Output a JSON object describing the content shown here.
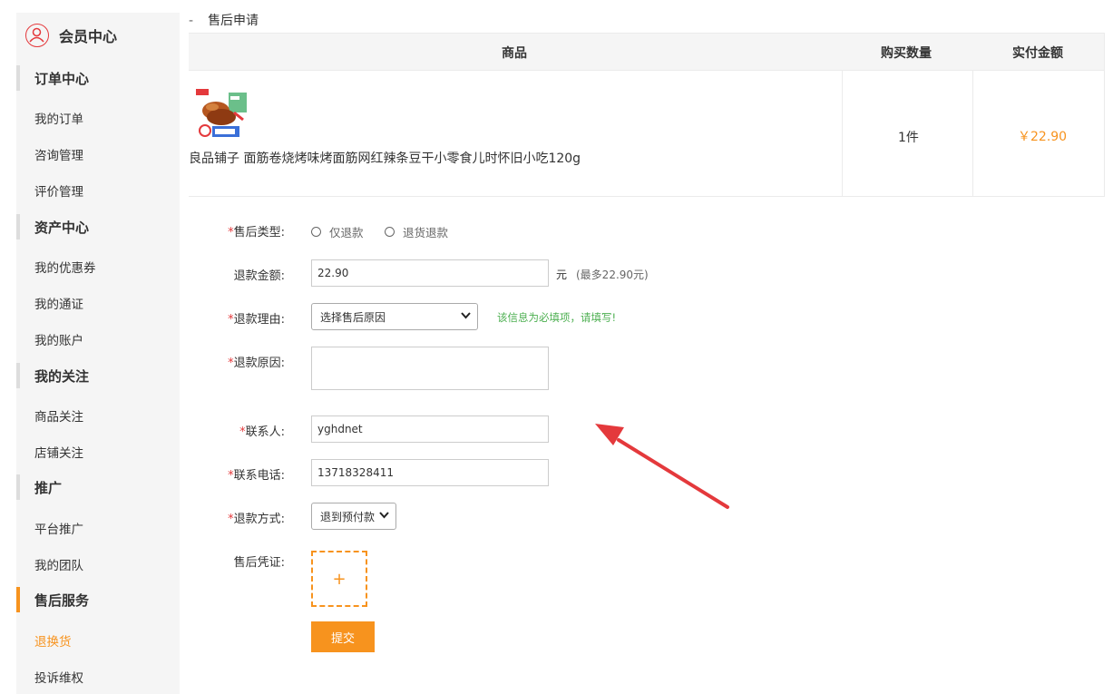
{
  "sidebar": {
    "title": "会员中心",
    "groups": [
      {
        "label": "订单中心",
        "items": [
          "我的订单",
          "咨询管理",
          "评价管理"
        ]
      },
      {
        "label": "资产中心",
        "items": [
          "我的优惠券",
          "我的通证",
          "我的账户"
        ]
      },
      {
        "label": "我的关注",
        "items": [
          "商品关注",
          "店铺关注"
        ]
      },
      {
        "label": "推广",
        "items": [
          "平台推广",
          "我的团队"
        ]
      },
      {
        "label": "售后服务",
        "items": [
          "退换货",
          "投诉维权"
        ]
      }
    ],
    "active_item": "退换货"
  },
  "section": {
    "dash": "-",
    "title": "售后申请"
  },
  "table": {
    "headers": {
      "product": "商品",
      "quantity": "购买数量",
      "amount": "实付金额"
    },
    "row": {
      "name": "良品铺子 面筋卷烧烤味烤面筋网红辣条豆干小零食儿时怀旧小吃120g",
      "quantity": "1件",
      "amount": "￥22.90"
    }
  },
  "form": {
    "required_mark": "*",
    "type": {
      "label": "售后类型:",
      "options": [
        "仅退款",
        "退货退款"
      ]
    },
    "refund_amount": {
      "label": "退款金额:",
      "value": "22.90",
      "unit": "元",
      "hint": "(最多22.90元)"
    },
    "reason": {
      "label": "退款理由:",
      "selected": "选择售后原因",
      "warning": "该信息为必填项，请填写!"
    },
    "cause": {
      "label": "退款原因:",
      "value": ""
    },
    "contact": {
      "label": "联系人:",
      "value": "yghdnet"
    },
    "phone": {
      "label": "联系电话:",
      "value": "13718328411"
    },
    "method": {
      "label": "退款方式:",
      "selected": "退到预付款"
    },
    "proof": {
      "label": "售后凭证:",
      "upload_symbol": "+"
    },
    "submit_label": "提交"
  },
  "colors": {
    "accent": "#f7931e",
    "required": "#e4393c",
    "warning": "#4caf50",
    "arrow": "#e4393c"
  }
}
